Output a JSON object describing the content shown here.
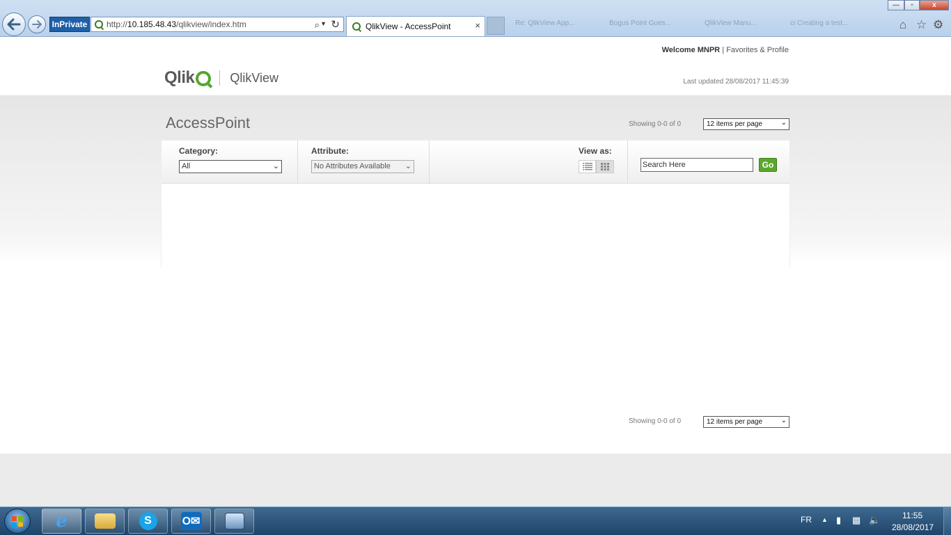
{
  "browser": {
    "inprivate_label": "InPrivate",
    "url_prefix": "http://",
    "url_host": "10.185.48.43",
    "url_path": "/qlikview/index.htm",
    "active_tab_title": "QlikView - AccessPoint",
    "background_tabs": [
      "Re: QlikView App...",
      "Bogus Point Gues...",
      "QlikView Manu...",
      "ci Creating a test..."
    ],
    "tab_close_glyph": "×",
    "window_buttons": {
      "minimize": "—",
      "maximize": "▫",
      "close": "x"
    }
  },
  "header": {
    "welcome_prefix": "Welcome MNPR",
    "separator": "|",
    "favorites_link": "Favorites & Profile",
    "logo_brand": "Qlik",
    "logo_product": "QlikView",
    "last_updated": "Last updated 28/08/2017 11:45:39"
  },
  "main": {
    "title": "AccessPoint",
    "showing_top": "Showing 0-0 of 0",
    "items_per_page_top": "12 items per page",
    "category_label": "Category:",
    "category_value": "All",
    "attribute_label": "Attribute:",
    "attribute_value": "No Attributes Available",
    "view_as_label": "View as:",
    "search_placeholder": "Search Here",
    "go_label": "Go",
    "showing_bottom": "Showing 0-0 of 0",
    "items_per_page_bottom": "12 items per page"
  },
  "taskbar": {
    "language": "FR",
    "time": "11:55",
    "date": "28/08/2017",
    "pinned": [
      "internet-explorer",
      "windows-explorer",
      "skype",
      "outlook",
      "remote-desktop"
    ]
  },
  "colors": {
    "qlik_green": "#52a72e",
    "go_button": "#5ba82c",
    "inprivate_blue": "#1f5fa8",
    "taskbar": "#2b5277"
  }
}
